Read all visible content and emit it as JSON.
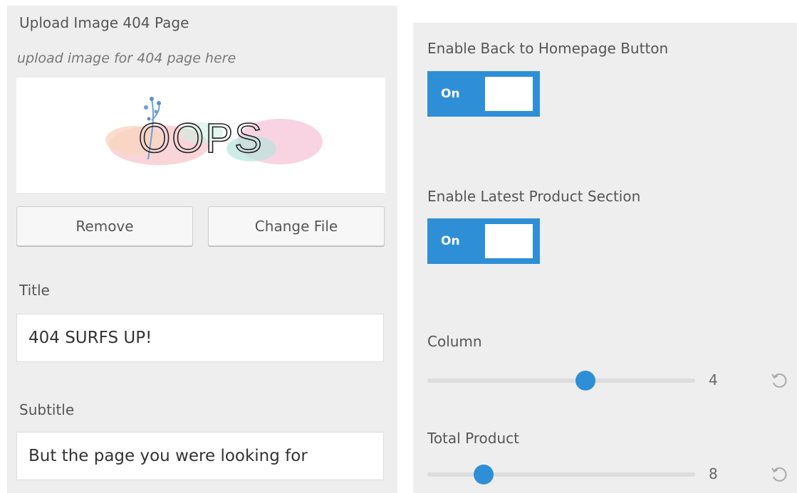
{
  "upload": {
    "label": "Upload Image 404 Page",
    "description": "upload image for 404 page here",
    "image_text": "OOPS",
    "remove_label": "Remove",
    "change_label": "Change File"
  },
  "title": {
    "label": "Title",
    "value": "404 SURFS UP!"
  },
  "subtitle": {
    "label": "Subtitle",
    "value": "But the page you were looking for"
  },
  "back_button": {
    "label": "Enable Back to Homepage Button",
    "toggle_text": "On"
  },
  "latest_product": {
    "label": "Enable Latest Product Section",
    "toggle_text": "On"
  },
  "column": {
    "label": "Column",
    "value": "4",
    "fraction": 0.59
  },
  "total_product": {
    "label": "Total Product",
    "value": "8",
    "fraction": 0.21
  },
  "colors": {
    "accent": "#2e8fd6",
    "panel_bg": "#eeeeee"
  },
  "icons": {
    "reset": "reset-icon"
  }
}
